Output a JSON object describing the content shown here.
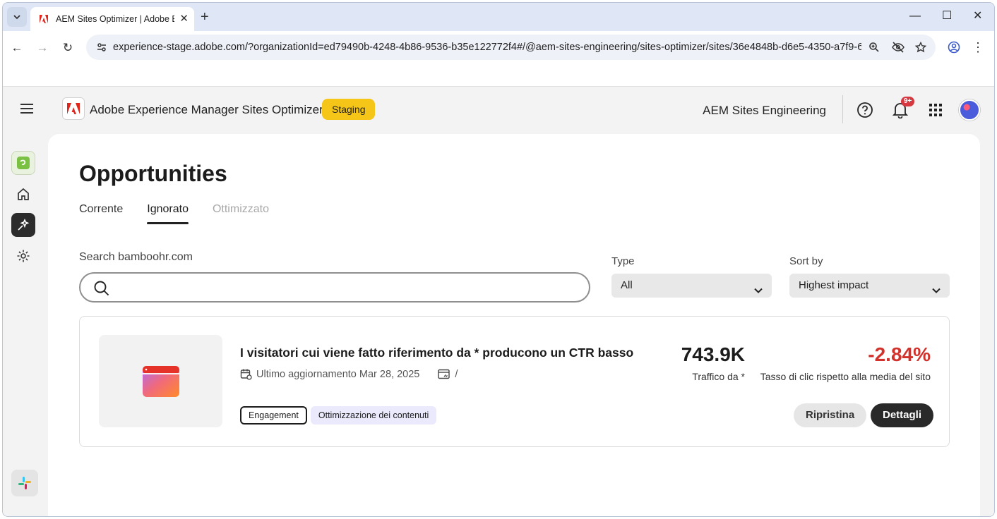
{
  "browser": {
    "tab_title": "AEM Sites Optimizer | Adobe Exp",
    "url": "experience-stage.adobe.com/?organizationId=ed79490b-4248-4b86-9536-b35e122772f4#/@aem-sites-engineering/sites-optimizer/sites/36e4848b-d6e5-4350-a7f9-610e..."
  },
  "header": {
    "app_name": "Adobe Experience Manager Sites Optimizer",
    "env_badge": "Staging",
    "org_name": "AEM Sites Engineering",
    "notification_count": "9+"
  },
  "page": {
    "title": "Opportunities",
    "tabs": [
      {
        "label": "Corrente",
        "state": "default"
      },
      {
        "label": "Ignorato",
        "state": "active"
      },
      {
        "label": "Ottimizzato",
        "state": "disabled"
      }
    ],
    "search": {
      "label": "Search bamboohr.com",
      "value": "",
      "placeholder": ""
    },
    "type_filter": {
      "label": "Type",
      "value": "All"
    },
    "sort_filter": {
      "label": "Sort by",
      "value": "Highest impact"
    }
  },
  "card": {
    "title": "I visitatori cui viene fatto riferimento da * producono un CTR basso",
    "updated": "Ultimo aggiornamento Mar 28, 2025",
    "path": "/",
    "tags": [
      "Engagement",
      "Ottimizzazione dei contenuti"
    ],
    "metric1": {
      "value": "743.9K",
      "label": "Traffico da *"
    },
    "metric2": {
      "value": "-2.84%",
      "label": "Tasso di clic rispetto alla media del sito",
      "color": "#d1322b"
    },
    "restore_label": "Ripristina",
    "details_label": "Dettagli"
  },
  "icons": {
    "rail": [
      "app-logo-icon",
      "home-icon",
      "opportunities-icon",
      "settings-icon",
      "slack-icon"
    ]
  }
}
